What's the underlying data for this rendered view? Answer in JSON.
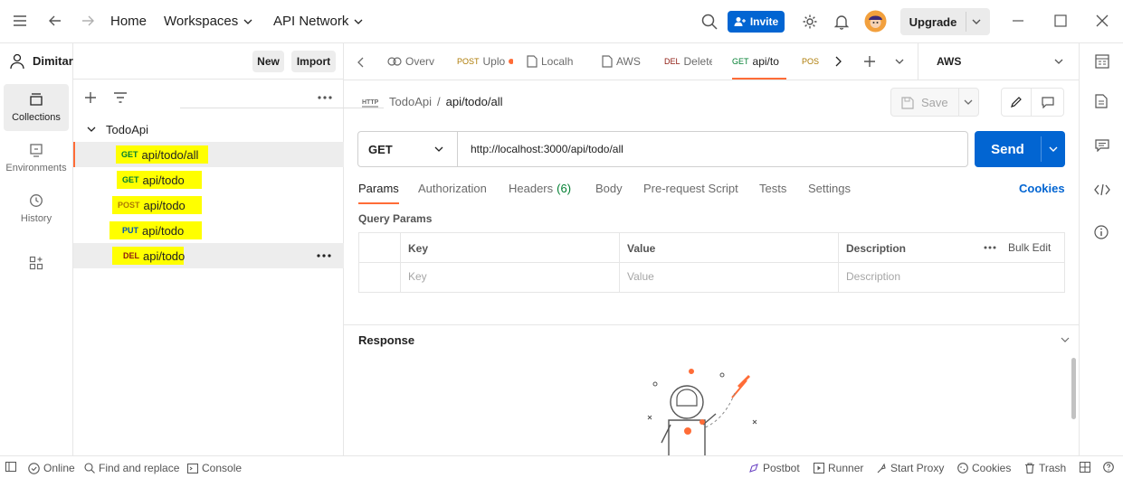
{
  "topbar": {
    "home": "Home",
    "workspaces": "Workspaces",
    "api_network": "API Network",
    "invite": "Invite",
    "upgrade": "Upgrade"
  },
  "sidebar": {
    "workspace_user": "Dimitar",
    "new_button": "New",
    "import_button": "Import",
    "rail": [
      {
        "label": "Collections",
        "icon": "collections-icon"
      },
      {
        "label": "Environments",
        "icon": "environments-icon"
      },
      {
        "label": "History",
        "icon": "history-icon"
      },
      {
        "label": "",
        "icon": "apps-icon"
      }
    ],
    "collection_name": "TodoApi",
    "requests": [
      {
        "method": "GET",
        "path": "api/todo/all",
        "color": "#007f31"
      },
      {
        "method": "GET",
        "path": "api/todo",
        "color": "#007f31"
      },
      {
        "method": "POST",
        "path": "api/todo",
        "color": "#ad7a03"
      },
      {
        "method": "PUT",
        "path": "api/todo",
        "color": "#0053b8"
      },
      {
        "method": "DEL",
        "path": "api/todo",
        "color": "#8e1a10"
      }
    ]
  },
  "tabs": [
    {
      "method": "",
      "label": "Overv"
    },
    {
      "method": "POST",
      "label": "Uplo"
    },
    {
      "method": "",
      "label": "Localh"
    },
    {
      "method": "",
      "label": "AWS"
    },
    {
      "method": "DEL",
      "label": "Delete"
    },
    {
      "method": "GET",
      "label": "api/to"
    },
    {
      "method": "POS",
      "label": ""
    }
  ],
  "environment": "AWS",
  "request": {
    "breadcrumb_collection": "TodoApi",
    "breadcrumb_sep": "/",
    "breadcrumb_name": "api/todo/all",
    "save": "Save",
    "method": "GET",
    "url": "http://localhost:3000/api/todo/all",
    "send": "Send",
    "param_tabs": [
      "Params",
      "Authorization",
      "Headers",
      "Body",
      "Pre-request Script",
      "Tests",
      "Settings"
    ],
    "headers_count": "(6)",
    "cookies": "Cookies",
    "query_params_title": "Query Params",
    "columns": [
      "Key",
      "Value",
      "Description"
    ],
    "bulk_edit": "Bulk Edit",
    "placeholders": [
      "Key",
      "Value",
      "Description"
    ]
  },
  "response": {
    "title": "Response"
  },
  "statusbar": {
    "online": "Online",
    "find_replace": "Find and replace",
    "console": "Console",
    "postbot": "Postbot",
    "runner": "Runner",
    "start_proxy": "Start Proxy",
    "cookies": "Cookies",
    "trash": "Trash"
  },
  "colors": {
    "accent": "#ff6c37",
    "primary": "#0265d2",
    "highlight": "#ffff00",
    "get": "#007f31",
    "post": "#ad7a03",
    "put": "#0053b8",
    "del": "#8e1a10"
  }
}
